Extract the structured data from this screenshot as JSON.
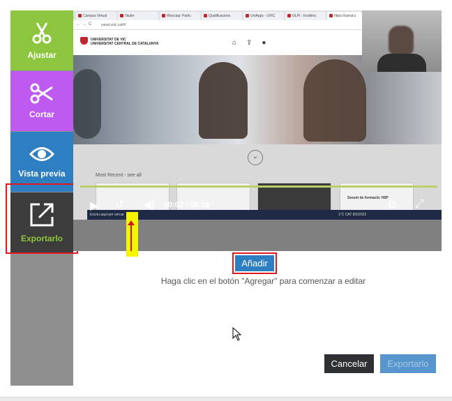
{
  "sidebar": {
    "items": [
      {
        "label": "Ajustar",
        "icon": "scissors-icon",
        "color": "#8cc63e"
      },
      {
        "label": "Cortar",
        "icon": "scissors-open-icon",
        "color": "#bf5af0"
      },
      {
        "label": "Vista previa",
        "icon": "eye-icon",
        "color": "#2e7fc2"
      },
      {
        "label": "Exportarlo",
        "icon": "export-icon",
        "color": "#3c3c3c",
        "active": true
      }
    ]
  },
  "video": {
    "browser_tabs": [
      "Campus Virtual",
      "Tauler",
      "Wooclap: Partic",
      "Qualificacions",
      "UniApps - UVIC",
      "GLPI - Incidènc",
      "https://canal.u"
    ],
    "address": "canal.uvic.cat/#/",
    "university_line1": "UNIVERSITAT DE VIC",
    "university_line2": "UNIVERSITAT CENTRAL DE CATALUNYA",
    "most_recent": "Most Recent - see all",
    "thumb_title": "Sessió de formació: H5P",
    "current_time": "00:02",
    "duration": "00:16",
    "taskbar_search": "Escriu aquí per cercar",
    "taskbar_tray": "1°C   CAT   8/2/2022"
  },
  "main": {
    "add_button": "Añadir",
    "hint": "Haga clic en el botón \"Agregar\" para comenzar a editar"
  },
  "footer": {
    "cancel": "Cancelar",
    "export": "Exportarlo"
  },
  "colors": {
    "accent_blue": "#2e7fc2",
    "highlight_red": "#e0191f",
    "marker_yellow": "#f5f500"
  }
}
